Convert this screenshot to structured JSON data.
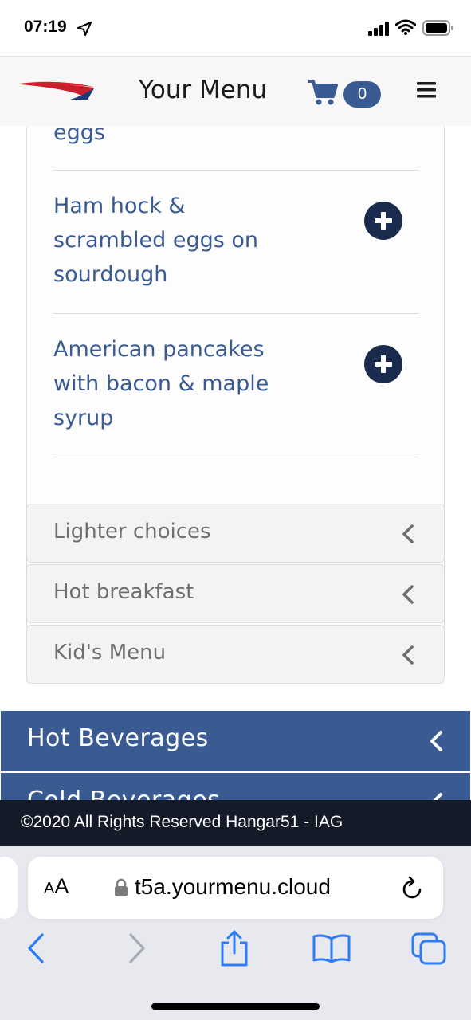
{
  "status_bar": {
    "time": "07:19"
  },
  "header": {
    "title": "Your Menu",
    "cart_count": "0"
  },
  "menu_items": [
    {
      "name": "eggs"
    },
    {
      "name_lines": [
        "Ham hock &",
        "scrambled eggs on",
        "sourdough"
      ]
    },
    {
      "name_lines": [
        "American pancakes",
        "with bacon & maple",
        "syrup"
      ]
    }
  ],
  "subcategories": [
    {
      "label": "Lighter choices"
    },
    {
      "label": "Hot breakfast"
    },
    {
      "label": "Kid's Menu"
    }
  ],
  "categories": [
    {
      "label": "Hot Beverages"
    },
    {
      "label": "Cold Beverages"
    }
  ],
  "footer": {
    "text": "©2020 All Rights Reserved Hangar51 - IAG"
  },
  "browser": {
    "aa_small": "A",
    "aa_big": "A",
    "url": "t5a.yourmenu.cloud"
  },
  "colors": {
    "brand_blue": "#3a5a92",
    "dark_navy": "#1a2b4d",
    "footer_bg": "#141a28"
  },
  "icons": {
    "status": [
      "location-arrow-icon",
      "signal-icon",
      "wifi-icon",
      "battery-icon"
    ],
    "header": [
      "british-airways-logo",
      "cart-icon",
      "hamburger-menu-icon"
    ],
    "browser": [
      "lock-icon",
      "reload-icon",
      "back-icon",
      "forward-icon",
      "share-icon",
      "bookmarks-icon",
      "tabs-icon"
    ]
  }
}
